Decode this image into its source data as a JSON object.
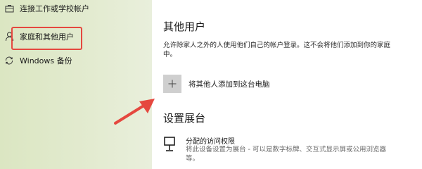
{
  "nav": {
    "items": [
      {
        "label": "连接工作或学校帐户",
        "icon": "briefcase-icon"
      },
      {
        "label": "家庭和其他用户",
        "icon": "person-icon",
        "highlighted": true
      },
      {
        "label": "Windows 备份",
        "icon": "sync-icon"
      }
    ]
  },
  "other_users": {
    "title": "其他用户",
    "description": "允许除家人之外的人使用他们自己的帐户登录。这不会将他们添加到你的家庭中。",
    "add_button_label": "将其他人添加到这台电脑"
  },
  "kiosk": {
    "title": "设置展台",
    "item_title": "分配的访问权限",
    "item_description": "将此设备设置为展台 - 可以是数字标牌、交互式显示屏或公用浏览器等。"
  },
  "colors": {
    "annotation": "#e5483f",
    "nav_background": "#dfe8c9",
    "tile": "#cfcfcf"
  }
}
